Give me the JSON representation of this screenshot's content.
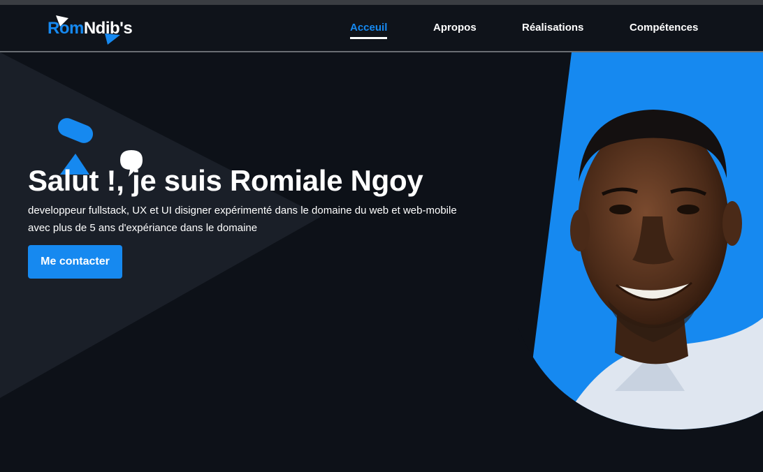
{
  "brand": {
    "logo_part1": "Rom",
    "logo_part2": "Ndib's"
  },
  "nav": {
    "items": [
      {
        "label": "Acceuil",
        "active": true
      },
      {
        "label": "Apropos",
        "active": false
      },
      {
        "label": "Réalisations",
        "active": false
      },
      {
        "label": "Compétences",
        "active": false
      }
    ]
  },
  "hero": {
    "title": "Salut !, je suis Romiale Ngoy",
    "subtitle_line1": "developpeur fullstack, UX et UI disigner expérimenté dans le domaine du web et web-mobile",
    "subtitle_line2": "avec plus de 5 ans d'expériance dans le domaine",
    "cta_label": "Me contacter"
  },
  "colors": {
    "accent": "#1689f0",
    "background": "#0d1118",
    "navbar": "#0f131a",
    "text": "#ffffff"
  },
  "icons": {
    "logo_mark_top": "triangle-icon",
    "logo_mark_bottom": "triangle-icon",
    "deco_pill": "pill-shape",
    "deco_triangle": "triangle-shape",
    "deco_bubble": "speech-bubble-icon"
  }
}
